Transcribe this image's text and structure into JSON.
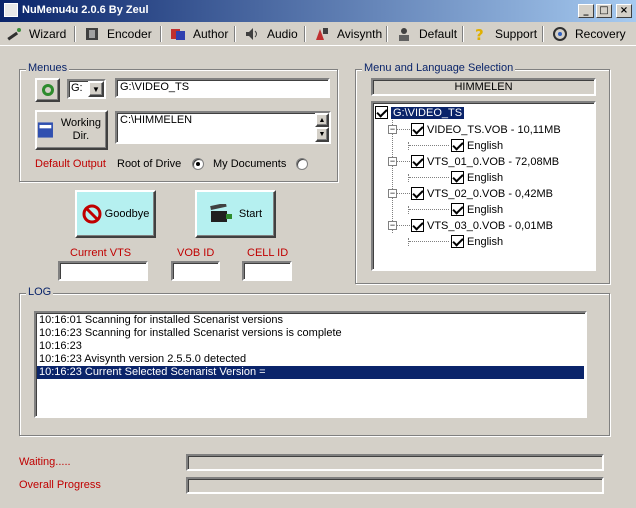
{
  "window": {
    "title": "NuMenu4u 2.0.6 By Zeul",
    "min": "_",
    "max": "□",
    "close": "×"
  },
  "toolbar": {
    "items": [
      {
        "label": "Wizard",
        "icon": "wand-icon"
      },
      {
        "label": "Encoder",
        "icon": "film-icon"
      },
      {
        "label": "Author",
        "icon": "author-icon"
      },
      {
        "label": "Audio",
        "icon": "speaker-icon"
      },
      {
        "label": "Avisynth",
        "icon": "avisynth-icon"
      },
      {
        "label": "Default",
        "icon": "default-icon"
      },
      {
        "label": "Support",
        "icon": "question-icon"
      },
      {
        "label": "Recovery",
        "icon": "recovery-icon"
      }
    ]
  },
  "menues": {
    "label": "Menues",
    "drive": "G:",
    "source_path": "G:\\VIDEO_TS",
    "working_dir_label": "Working Dir.",
    "working_dir_path": "C:\\HIMMELEN",
    "default_output_label": "Default Output",
    "root_of_drive_label": "Root of Drive",
    "my_documents_label": "My Documents",
    "selected_output": "Root of Drive"
  },
  "actions": {
    "goodbye": "Goodbye",
    "start": "Start"
  },
  "ids": {
    "current_vts": "Current VTS",
    "vob_id": "VOB ID",
    "cell_id": "CELL ID",
    "current_vts_value": "",
    "vob_id_value": "",
    "cell_id_value": ""
  },
  "selection": {
    "label": "Menu and Language Selection",
    "header": "HIMMELEN",
    "root": "G:\\VIDEO_TS",
    "items": [
      {
        "name": "VIDEO_TS.VOB - 10,11MB",
        "lang": "English"
      },
      {
        "name": "VTS_01_0.VOB - 72,08MB",
        "lang": "English"
      },
      {
        "name": "VTS_02_0.VOB - 0,42MB",
        "lang": "English"
      },
      {
        "name": "VTS_03_0.VOB - 0,01MB",
        "lang": "English"
      }
    ]
  },
  "log": {
    "label": "LOG",
    "lines": [
      "10:16:01 Scanning for installed Scenarist versions",
      "10:16:23 Scanning for installed Scenarist versions is complete",
      "10:16:23",
      "10:16:23 Avisynth version 2.5.5.0 detected",
      "10:16:23 Current Selected Scenarist Version ="
    ],
    "selected_index": 4
  },
  "status": {
    "waiting": "Waiting.....",
    "overall": "Overall Progress",
    "waiting_progress": 0,
    "overall_progress": 0
  },
  "colors": {
    "accent": "#0a246a",
    "red_label": "#c00000",
    "big_button": "#b5f0f0"
  }
}
